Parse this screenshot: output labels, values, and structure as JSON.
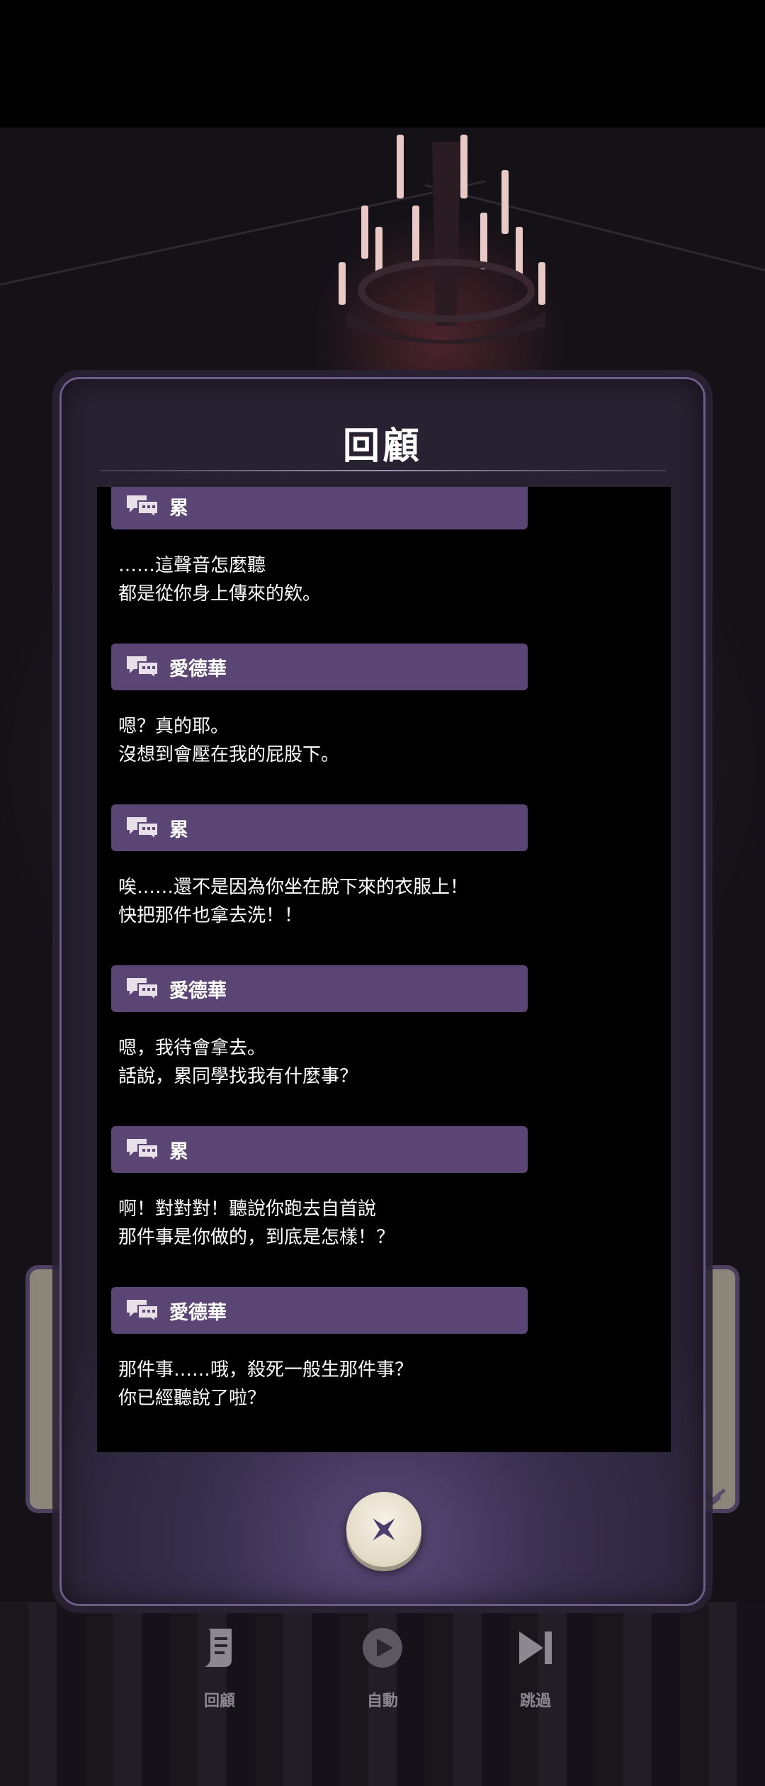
{
  "dialog": {
    "title": "回顧",
    "entries": [
      {
        "speaker": "累",
        "lines": [
          "……這聲音怎麼聽",
          "都是從你身上傳來的欸。"
        ]
      },
      {
        "speaker": "愛德華",
        "lines": [
          "嗯？真的耶。",
          "沒想到會壓在我的屁股下。"
        ]
      },
      {
        "speaker": "累",
        "lines": [
          "唉……還不是因為你坐在脫下來的衣服上！",
          "快把那件也拿去洗！！"
        ]
      },
      {
        "speaker": "愛德華",
        "lines": [
          "嗯，我待會拿去。",
          "話說，累同學找我有什麼事？"
        ]
      },
      {
        "speaker": "累",
        "lines": [
          "啊！對對對！聽說你跑去自首說",
          "那件事是你做的，到底是怎樣！？"
        ]
      },
      {
        "speaker": "愛德華",
        "lines": [
          "那件事……哦，殺死一般生那件事？",
          "你已經聽說了啦？"
        ]
      }
    ],
    "close_icon": "close-x-icon"
  },
  "bottom_bar": {
    "items": [
      {
        "label": "回顧",
        "icon": "scroll-icon"
      },
      {
        "label": "自動",
        "icon": "play-icon"
      },
      {
        "label": "跳過",
        "icon": "skip-icon"
      }
    ]
  },
  "colors": {
    "name_bar": "#5a4574",
    "modal_border": "#6b5d85",
    "log_bg": "#000000"
  }
}
